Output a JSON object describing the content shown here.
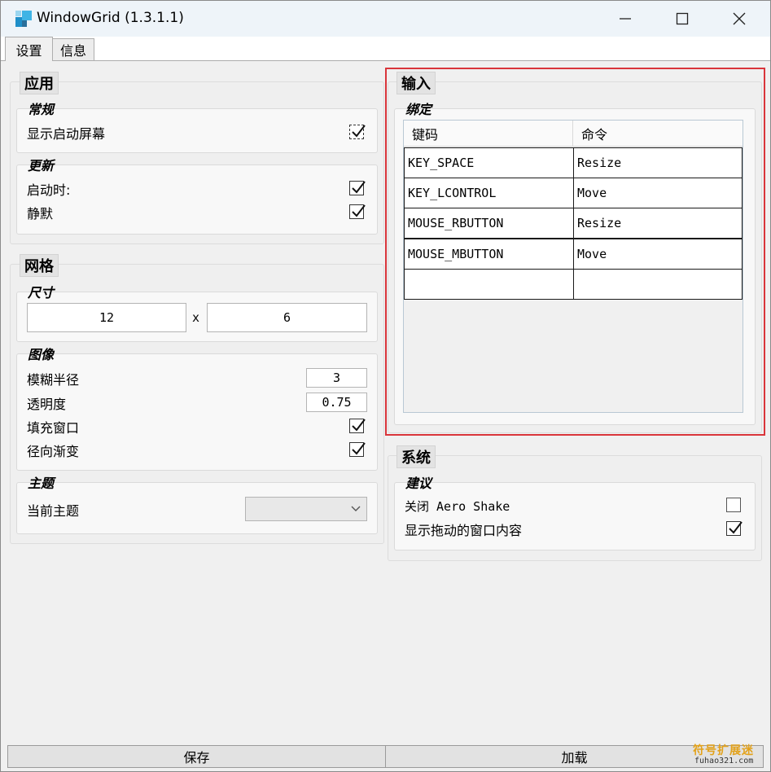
{
  "window": {
    "title": "WindowGrid (1.3.1.1)",
    "accent": "#d9353b"
  },
  "tabs": [
    {
      "label": "设置",
      "active": true
    },
    {
      "label": "信息",
      "active": false
    }
  ],
  "app_section": {
    "title": "应用",
    "general": {
      "label": "常规",
      "show_splash_label": "显示启动屏幕",
      "show_splash_checked": true
    },
    "update": {
      "label": "更新",
      "on_start_label": "启动时:",
      "on_start_checked": true,
      "silent_label": "静默",
      "silent_checked": true
    }
  },
  "grid_section": {
    "title": "网格",
    "size": {
      "label": "尺寸",
      "width": "12",
      "separator": "x",
      "height": "6"
    },
    "image": {
      "label": "图像",
      "blur_label": "模糊半径",
      "blur_value": "3",
      "opacity_label": "透明度",
      "opacity_value": "0.75",
      "fill_label": "填充窗口",
      "fill_checked": true,
      "radial_label": "径向渐变",
      "radial_checked": true
    },
    "theme": {
      "label": "主题",
      "current_label": "当前主题",
      "current_value": ""
    }
  },
  "input_section": {
    "title": "输入",
    "binding": {
      "label": "绑定",
      "headers": [
        "键码",
        "命令"
      ],
      "rows": [
        [
          "KEY_SPACE",
          "Resize"
        ],
        [
          "KEY_LCONTROL",
          "Move"
        ],
        [
          "MOUSE_RBUTTON",
          "Resize"
        ],
        [
          "MOUSE_MBUTTON",
          "Move"
        ],
        [
          "",
          ""
        ]
      ]
    }
  },
  "system_section": {
    "title": "系统",
    "advice": {
      "label": "建议",
      "aero_label": "关闭 Aero Shake",
      "aero_checked": false,
      "drag_label": "显示拖动的窗口内容",
      "drag_checked": true
    }
  },
  "footer": {
    "save_label": "保存",
    "load_label": "加载"
  },
  "watermark": {
    "top": "符号扩展迷",
    "bottom": "fuhao321.com"
  }
}
